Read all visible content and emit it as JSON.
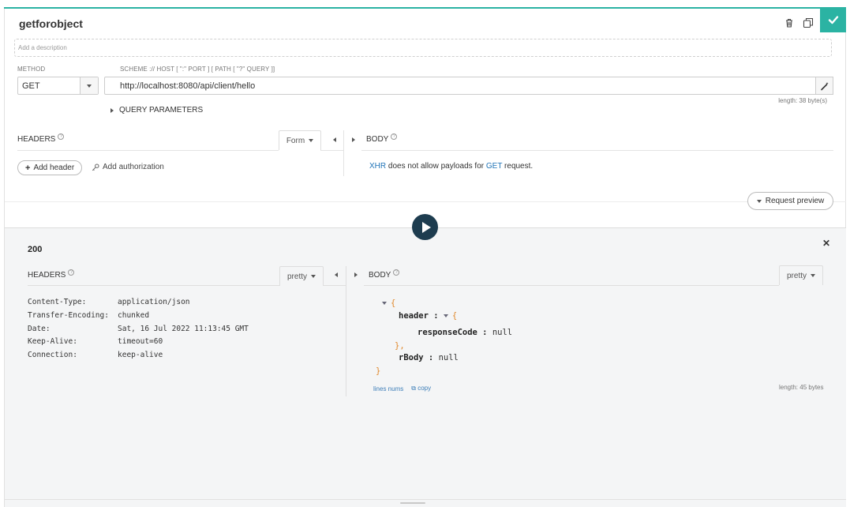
{
  "request": {
    "name": "getforobject",
    "description_placeholder": "Add a description",
    "method_label": "METHOD",
    "method_value": "GET",
    "url_label": "SCHEME :// HOST [ \":\" PORT ] [ PATH [ \"?\" QUERY ]]",
    "url_value": "http://localhost:8080/api/client/hello",
    "url_length": "length: 38 byte(s)",
    "query_params_label": "QUERY PARAMETERS",
    "headers_title": "HEADERS",
    "headers_mode": "Form",
    "add_header_label": "Add header",
    "add_authorization_label": "Add authorization",
    "body_title": "BODY",
    "body_message": {
      "xhr": "XHR",
      "middle": "does not allow payloads for",
      "method": "GET",
      "end": "request."
    },
    "request_preview_label": "Request preview"
  },
  "response": {
    "status": "200",
    "headers_title": "HEADERS",
    "headers_mode": "pretty",
    "body_title": "BODY",
    "body_mode": "pretty",
    "headers": [
      {
        "key": "Content-Type:",
        "value": "application/json"
      },
      {
        "key": "Transfer-Encoding:",
        "value": "chunked"
      },
      {
        "key": "Date:",
        "value": "Sat, 16 Jul 2022 11:13:45 GMT"
      },
      {
        "key": "Keep-Alive:",
        "value": "timeout=60"
      },
      {
        "key": "Connection:",
        "value": "keep-alive"
      }
    ],
    "json": {
      "open": "{",
      "header_key": "header",
      "header_open": "{",
      "response_code_key": "responseCode",
      "response_code_value": "null",
      "header_close": "},",
      "rbody_key": "rBody",
      "rbody_value": "null",
      "close": "}"
    },
    "lines_nums_label": "lines nums",
    "copy_label": "copy",
    "body_length": "length: 45 bytes"
  },
  "icons": {
    "confirm": "check-icon",
    "delete": "trash-icon",
    "duplicate": "copy-icon",
    "beautify": "magic-wand-icon",
    "authorization": "key-icon",
    "send": "play-icon",
    "close": "close-icon"
  },
  "colors": {
    "accent": "#2bb3a3",
    "play_button": "#1d3c4f",
    "link": "#1f73b7",
    "json_brace": "#e0882b"
  }
}
